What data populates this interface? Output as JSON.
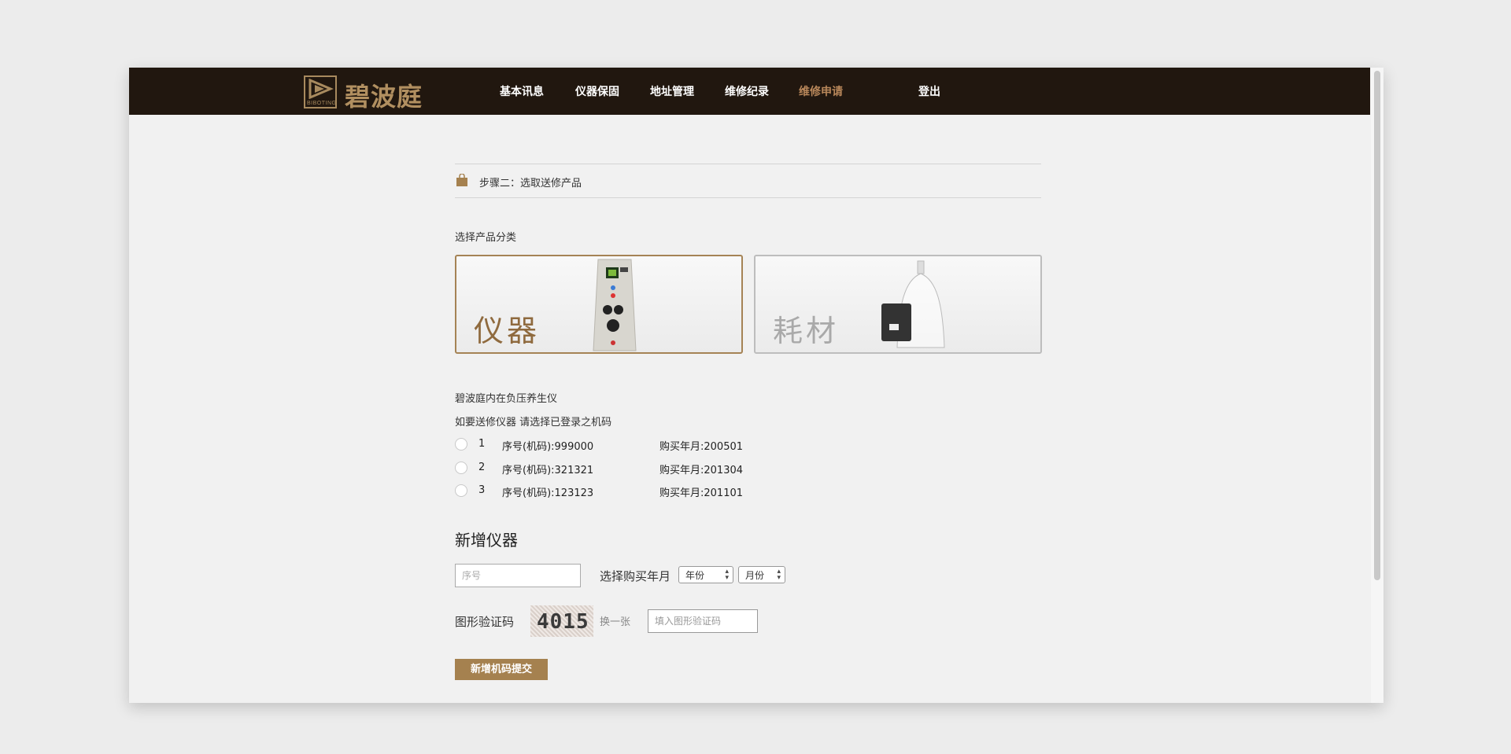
{
  "nav": {
    "logo_text": "碧波庭",
    "logo_sub": "BIBOTING",
    "items": [
      "基本讯息",
      "仪器保固",
      "地址管理",
      "维修纪录",
      "维修申请"
    ],
    "active": "维修申请",
    "logout": "登出"
  },
  "step": {
    "text": "步骤二：选取送修产品"
  },
  "category": {
    "label": "选择产品分类",
    "instrument": "仪器",
    "consumable": "耗材"
  },
  "device": {
    "name": "碧波庭内在负压养生仪",
    "hint": "如要送修仪器 请选择已登录之机码",
    "rows": [
      {
        "num": "1",
        "serial": "序号(机码):999000",
        "date": "购买年月:200501"
      },
      {
        "num": "2",
        "serial": "序号(机码):321321",
        "date": "购买年月:201304"
      },
      {
        "num": "3",
        "serial": "序号(机码):123123",
        "date": "购买年月:201101"
      }
    ]
  },
  "add": {
    "heading": "新增仪器",
    "serial_placeholder": "序号",
    "select_label": "选择购买年月",
    "year": "年份",
    "month": "月份",
    "captcha_label": "图形验证码",
    "captcha_code": "4015",
    "refresh": "换一张",
    "captcha_placeholder": "填入图形验证码",
    "submit": "新增机码提交"
  },
  "colors": {
    "navbar": "#21170f",
    "accent": "#a5814f",
    "active_nav": "#b8875a"
  }
}
